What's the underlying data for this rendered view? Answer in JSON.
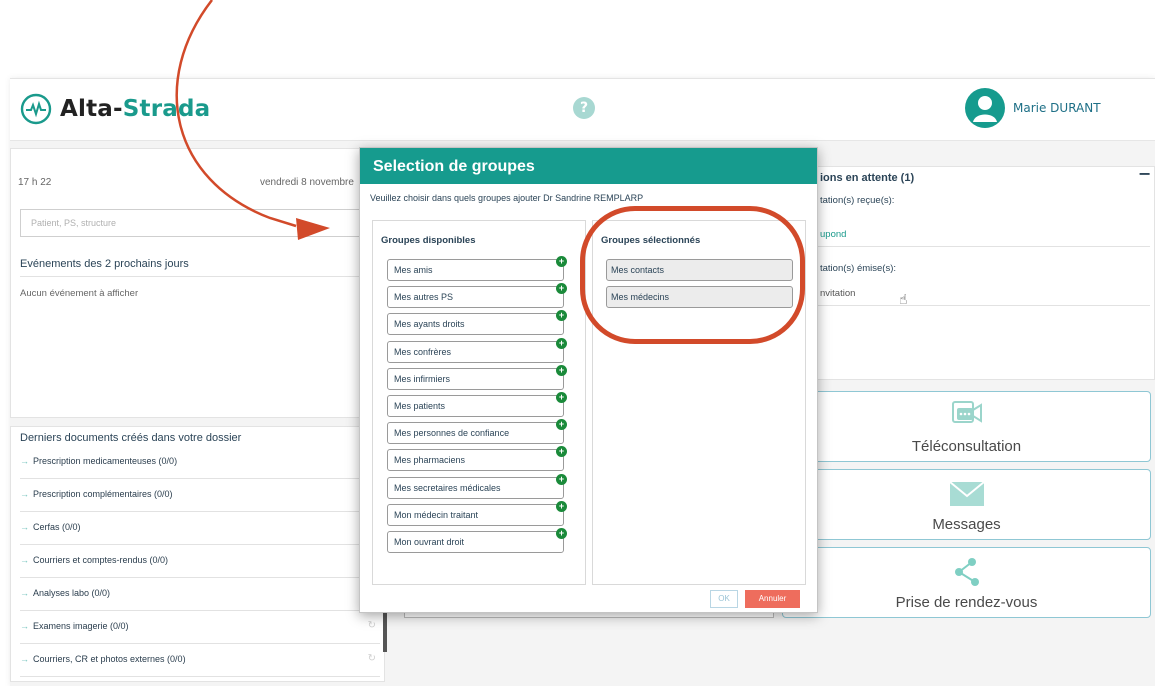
{
  "header": {
    "logo_part1": "Alta-",
    "logo_part2": "Strada",
    "help_label": "?",
    "user_name": "Marie DURANT"
  },
  "left": {
    "time": "17 h 22",
    "date": "vendredi 8 novembre",
    "search_placeholder": "Patient, PS, structure",
    "events_title": "Evénements des 2 prochains jours",
    "events_empty": "Aucun événement à afficher",
    "docs_title": "Derniers documents créés dans votre dossier",
    "docs": [
      "Prescription medicamenteuses (0/0)",
      "Prescription complémentaires (0/0)",
      "Cerfas (0/0)",
      "Courriers et comptes-rendus (0/0)",
      "Analyses labo (0/0)",
      "Examens imagerie (0/0)",
      "Courriers, CR et photos externes (0/0)"
    ]
  },
  "right": {
    "invite_title": "ions en attente (1)",
    "invite_received": "tation(s) reçue(s):",
    "invite_received_name": "upond",
    "invite_sent": "tation(s) émise(s):",
    "invite_sent_item": "nvitation",
    "tiles": [
      "Téléconsultation",
      "Messages",
      "Prise de rendez-vous"
    ]
  },
  "dialog": {
    "title": "Selection de groupes",
    "subtitle": "Veuillez choisir dans quels groupes ajouter Dr Sandrine REMPLARP",
    "available_title": "Groupes disponibles",
    "selected_title": "Groupes sélectionnés",
    "available": [
      "Mes amis",
      "Mes autres PS",
      "Mes ayants droits",
      "Mes confrères",
      "Mes infirmiers",
      "Mes patients",
      "Mes personnes de confiance",
      "Mes pharmaciens",
      "Mes secretaires médicales",
      "Mon médecin traitant",
      "Mon ouvrant droit"
    ],
    "selected": [
      "Mes contacts",
      "Mes médecins"
    ],
    "ok_label": "OK",
    "cancel_label": "Annuler"
  },
  "colors": {
    "brand_teal": "#169b8e",
    "annotation_red": "#d24a2a",
    "cancel_red": "#ee6d5d",
    "add_green": "#1a8a3a"
  }
}
